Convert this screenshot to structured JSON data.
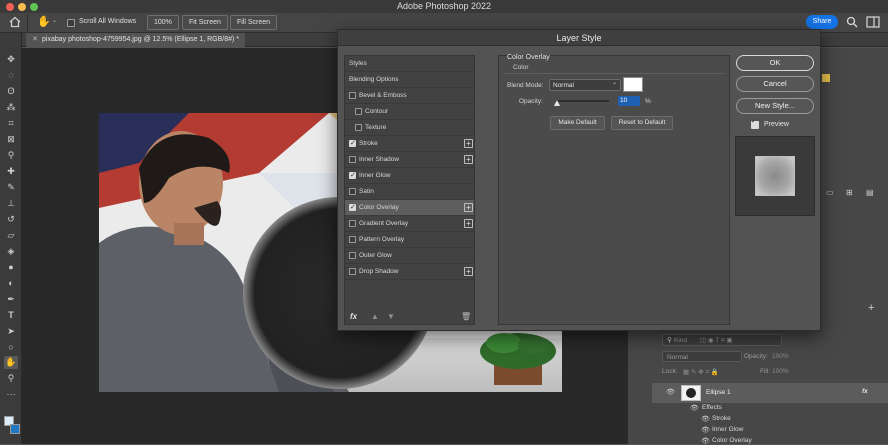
{
  "app": {
    "title": "Adobe Photoshop 2022"
  },
  "options_bar": {
    "scroll_all_windows": "Scroll All Windows",
    "zoom_100": "100%",
    "fit_screen": "Fit Screen",
    "fill_screen": "Fill Screen",
    "share": "Share"
  },
  "document": {
    "tab_label": "pixabay photoshop-4759954.jpg @ 12.5% (Ellipse 1, RGB/8#) *"
  },
  "dialog": {
    "title": "Layer Style",
    "list": [
      {
        "label": "Styles",
        "has_checkbox": false,
        "checked": false,
        "has_plus": false,
        "selected": false
      },
      {
        "label": "Blending Options",
        "has_checkbox": false,
        "checked": false,
        "has_plus": false,
        "selected": false
      },
      {
        "label": "Bevel & Emboss",
        "has_checkbox": true,
        "checked": false,
        "has_plus": false,
        "selected": false
      },
      {
        "label": "Contour",
        "has_checkbox": true,
        "checked": false,
        "has_plus": false,
        "selected": false,
        "indent": true
      },
      {
        "label": "Texture",
        "has_checkbox": true,
        "checked": false,
        "has_plus": false,
        "selected": false,
        "indent": true
      },
      {
        "label": "Stroke",
        "has_checkbox": true,
        "checked": true,
        "has_plus": true,
        "selected": false
      },
      {
        "label": "Inner Shadow",
        "has_checkbox": true,
        "checked": false,
        "has_plus": true,
        "selected": false
      },
      {
        "label": "Inner Glow",
        "has_checkbox": true,
        "checked": true,
        "has_plus": false,
        "selected": false
      },
      {
        "label": "Satin",
        "has_checkbox": true,
        "checked": false,
        "has_plus": false,
        "selected": false
      },
      {
        "label": "Color Overlay",
        "has_checkbox": true,
        "checked": true,
        "has_plus": true,
        "selected": true
      },
      {
        "label": "Gradient Overlay",
        "has_checkbox": true,
        "checked": false,
        "has_plus": true,
        "selected": false
      },
      {
        "label": "Pattern Overlay",
        "has_checkbox": true,
        "checked": false,
        "has_plus": false,
        "selected": false
      },
      {
        "label": "Outer Glow",
        "has_checkbox": true,
        "checked": false,
        "has_plus": false,
        "selected": false
      },
      {
        "label": "Drop Shadow",
        "has_checkbox": true,
        "checked": false,
        "has_plus": true,
        "selected": false
      }
    ],
    "fx_label": "fx",
    "section_title": "Color Overlay",
    "sub_title": "Color",
    "blend_mode_label": "Blend Mode:",
    "blend_mode_value": "Normal",
    "opacity_label": "Opacity:",
    "opacity_value": "10",
    "opacity_unit": "%",
    "overlay_color": "#ffffff",
    "make_default": "Make Default",
    "reset_to_default": "Reset to Default",
    "ok": "OK",
    "cancel": "Cancel",
    "new_style": "New Style...",
    "preview_label": "Preview",
    "preview_checked": true
  },
  "layers_panel": {
    "kind_placeholder": "Kind",
    "blend_mode": "Normal",
    "opacity_label": "Opacity:",
    "opacity_value": "100%",
    "lock_label": "Lock:",
    "fill_label": "Fill:",
    "fill_value": "100%",
    "layer_name": "Ellipse 1",
    "fx_badge": "fx",
    "effects_label": "Effects",
    "effects": [
      "Stroke",
      "Inner Glow",
      "Color Overlay"
    ]
  },
  "colors": {
    "accent": "#1473e6",
    "panel_dark": "#3b3b3b"
  }
}
